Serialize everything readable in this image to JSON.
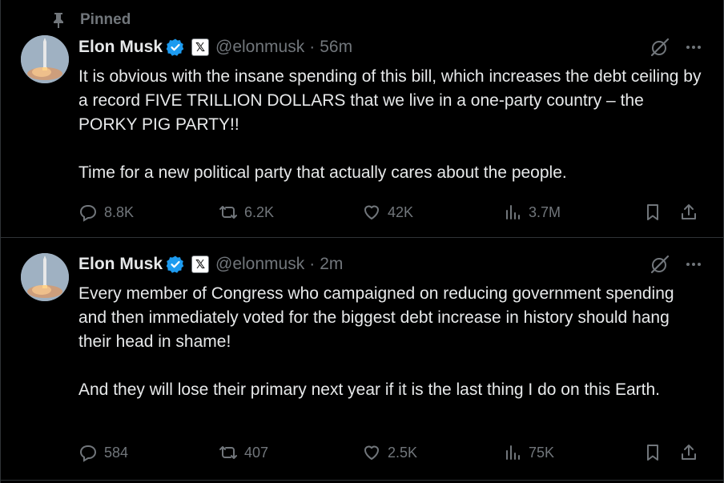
{
  "pinned": {
    "label": "Pinned",
    "icon": "pin-icon"
  },
  "tweets": [
    {
      "author": {
        "name": "Elon Musk",
        "handle": "@elonmusk",
        "verified_icon": "verified-badge-icon",
        "affiliation_icon": "x-logo-icon"
      },
      "separator": "·",
      "time": "56m",
      "text": "It is obvious with the insane spending of this bill, which increases the debt ceiling by a record FIVE TRILLION DOLLARS that we live in a one-party country – the PORKY PIG PARTY!!\n\nTime for a new political party that actually cares about the people.",
      "stats": {
        "replies": "8.8K",
        "reposts": "6.2K",
        "likes": "42K",
        "views": "3.7M"
      }
    },
    {
      "author": {
        "name": "Elon Musk",
        "handle": "@elonmusk",
        "verified_icon": "verified-badge-icon",
        "affiliation_icon": "x-logo-icon"
      },
      "separator": "·",
      "time": "2m",
      "text": "Every member of Congress who campaigned on reducing government spending and then immediately voted for the biggest debt increase in history should hang their head in shame!\n\nAnd they will lose their primary next year if it is the last thing I do on this Earth.",
      "stats": {
        "replies": "584",
        "reposts": "407",
        "likes": "2.5K",
        "views": "75K"
      }
    }
  ],
  "colors": {
    "background": "#000000",
    "text": "#e7e9ea",
    "muted": "#71767b",
    "verified": "#1d9bf0",
    "divider": "#2f3336"
  }
}
